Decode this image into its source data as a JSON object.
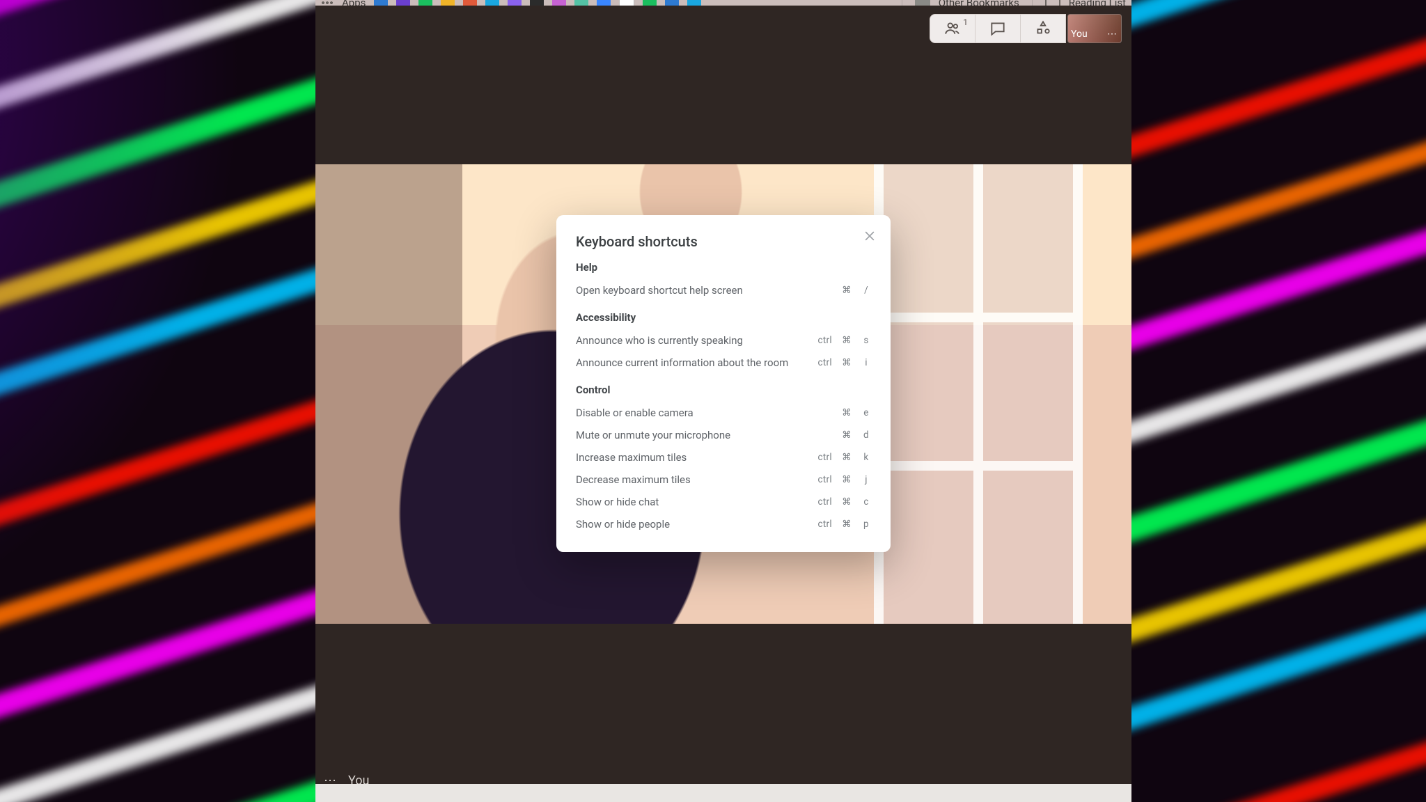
{
  "bookmarks": {
    "apps_label": "Apps",
    "other_label": "Other Bookmarks",
    "reading_list_label": "Reading List"
  },
  "meet": {
    "people_count": "1",
    "self_label": "You",
    "footer_self_label": "You"
  },
  "dialog": {
    "title": "Keyboard shortcuts",
    "sections": {
      "help": {
        "heading": "Help",
        "open_help": {
          "label": "Open keyboard shortcut help screen",
          "k1": "",
          "k2": "⌘",
          "k3": "/"
        }
      },
      "accessibility": {
        "heading": "Accessibility",
        "announce_speaking": {
          "label": "Announce who is currently speaking",
          "k1": "ctrl",
          "k2": "⌘",
          "k3": "s"
        },
        "announce_room": {
          "label": "Announce current information about the room",
          "k1": "ctrl",
          "k2": "⌘",
          "k3": "i"
        }
      },
      "control": {
        "heading": "Control",
        "camera": {
          "label": "Disable or enable camera",
          "k1": "",
          "k2": "⌘",
          "k3": "e"
        },
        "mic": {
          "label": "Mute or unmute your microphone",
          "k1": "",
          "k2": "⌘",
          "k3": "d"
        },
        "tiles_up": {
          "label": "Increase maximum tiles",
          "k1": "ctrl",
          "k2": "⌘",
          "k3": "k"
        },
        "tiles_dn": {
          "label": "Decrease maximum tiles",
          "k1": "ctrl",
          "k2": "⌘",
          "k3": "j"
        },
        "chat": {
          "label": "Show or hide chat",
          "k1": "ctrl",
          "k2": "⌘",
          "k3": "c"
        },
        "people": {
          "label": "Show or hide people",
          "k1": "ctrl",
          "k2": "⌘",
          "k3": "p"
        }
      }
    }
  }
}
